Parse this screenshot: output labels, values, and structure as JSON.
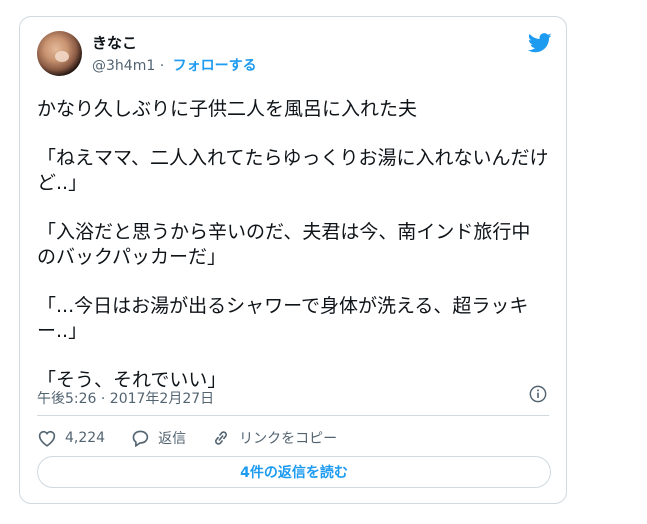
{
  "user": {
    "name": "きなこ",
    "handle": "@3h4m1",
    "separator": "·",
    "follow_label": "フォローする"
  },
  "tweet": {
    "paragraphs": [
      "かなり久しぶりに子供二人を風呂に入れた夫",
      "「ねえママ、二人入れてたらゆっくりお湯に入れないんだけど..」",
      "「入浴だと思うから辛いのだ、夫君は今、南インド旅行中のバックパッカーだ」",
      "「...今日はお湯が出るシャワーで身体が洗える、超ラッキー..」",
      "「そう、それでいい」"
    ],
    "timestamp": "午後5:26 · 2017年2月27日"
  },
  "actions": {
    "likes_count": "4,224",
    "reply_label": "返信",
    "copy_link_label": "リンクをコピー"
  },
  "replies_button": "4件の返信を読む",
  "colors": {
    "accent": "#1d9bf0",
    "text": "#0f1419",
    "muted": "#536471",
    "border": "#cfd9de"
  }
}
